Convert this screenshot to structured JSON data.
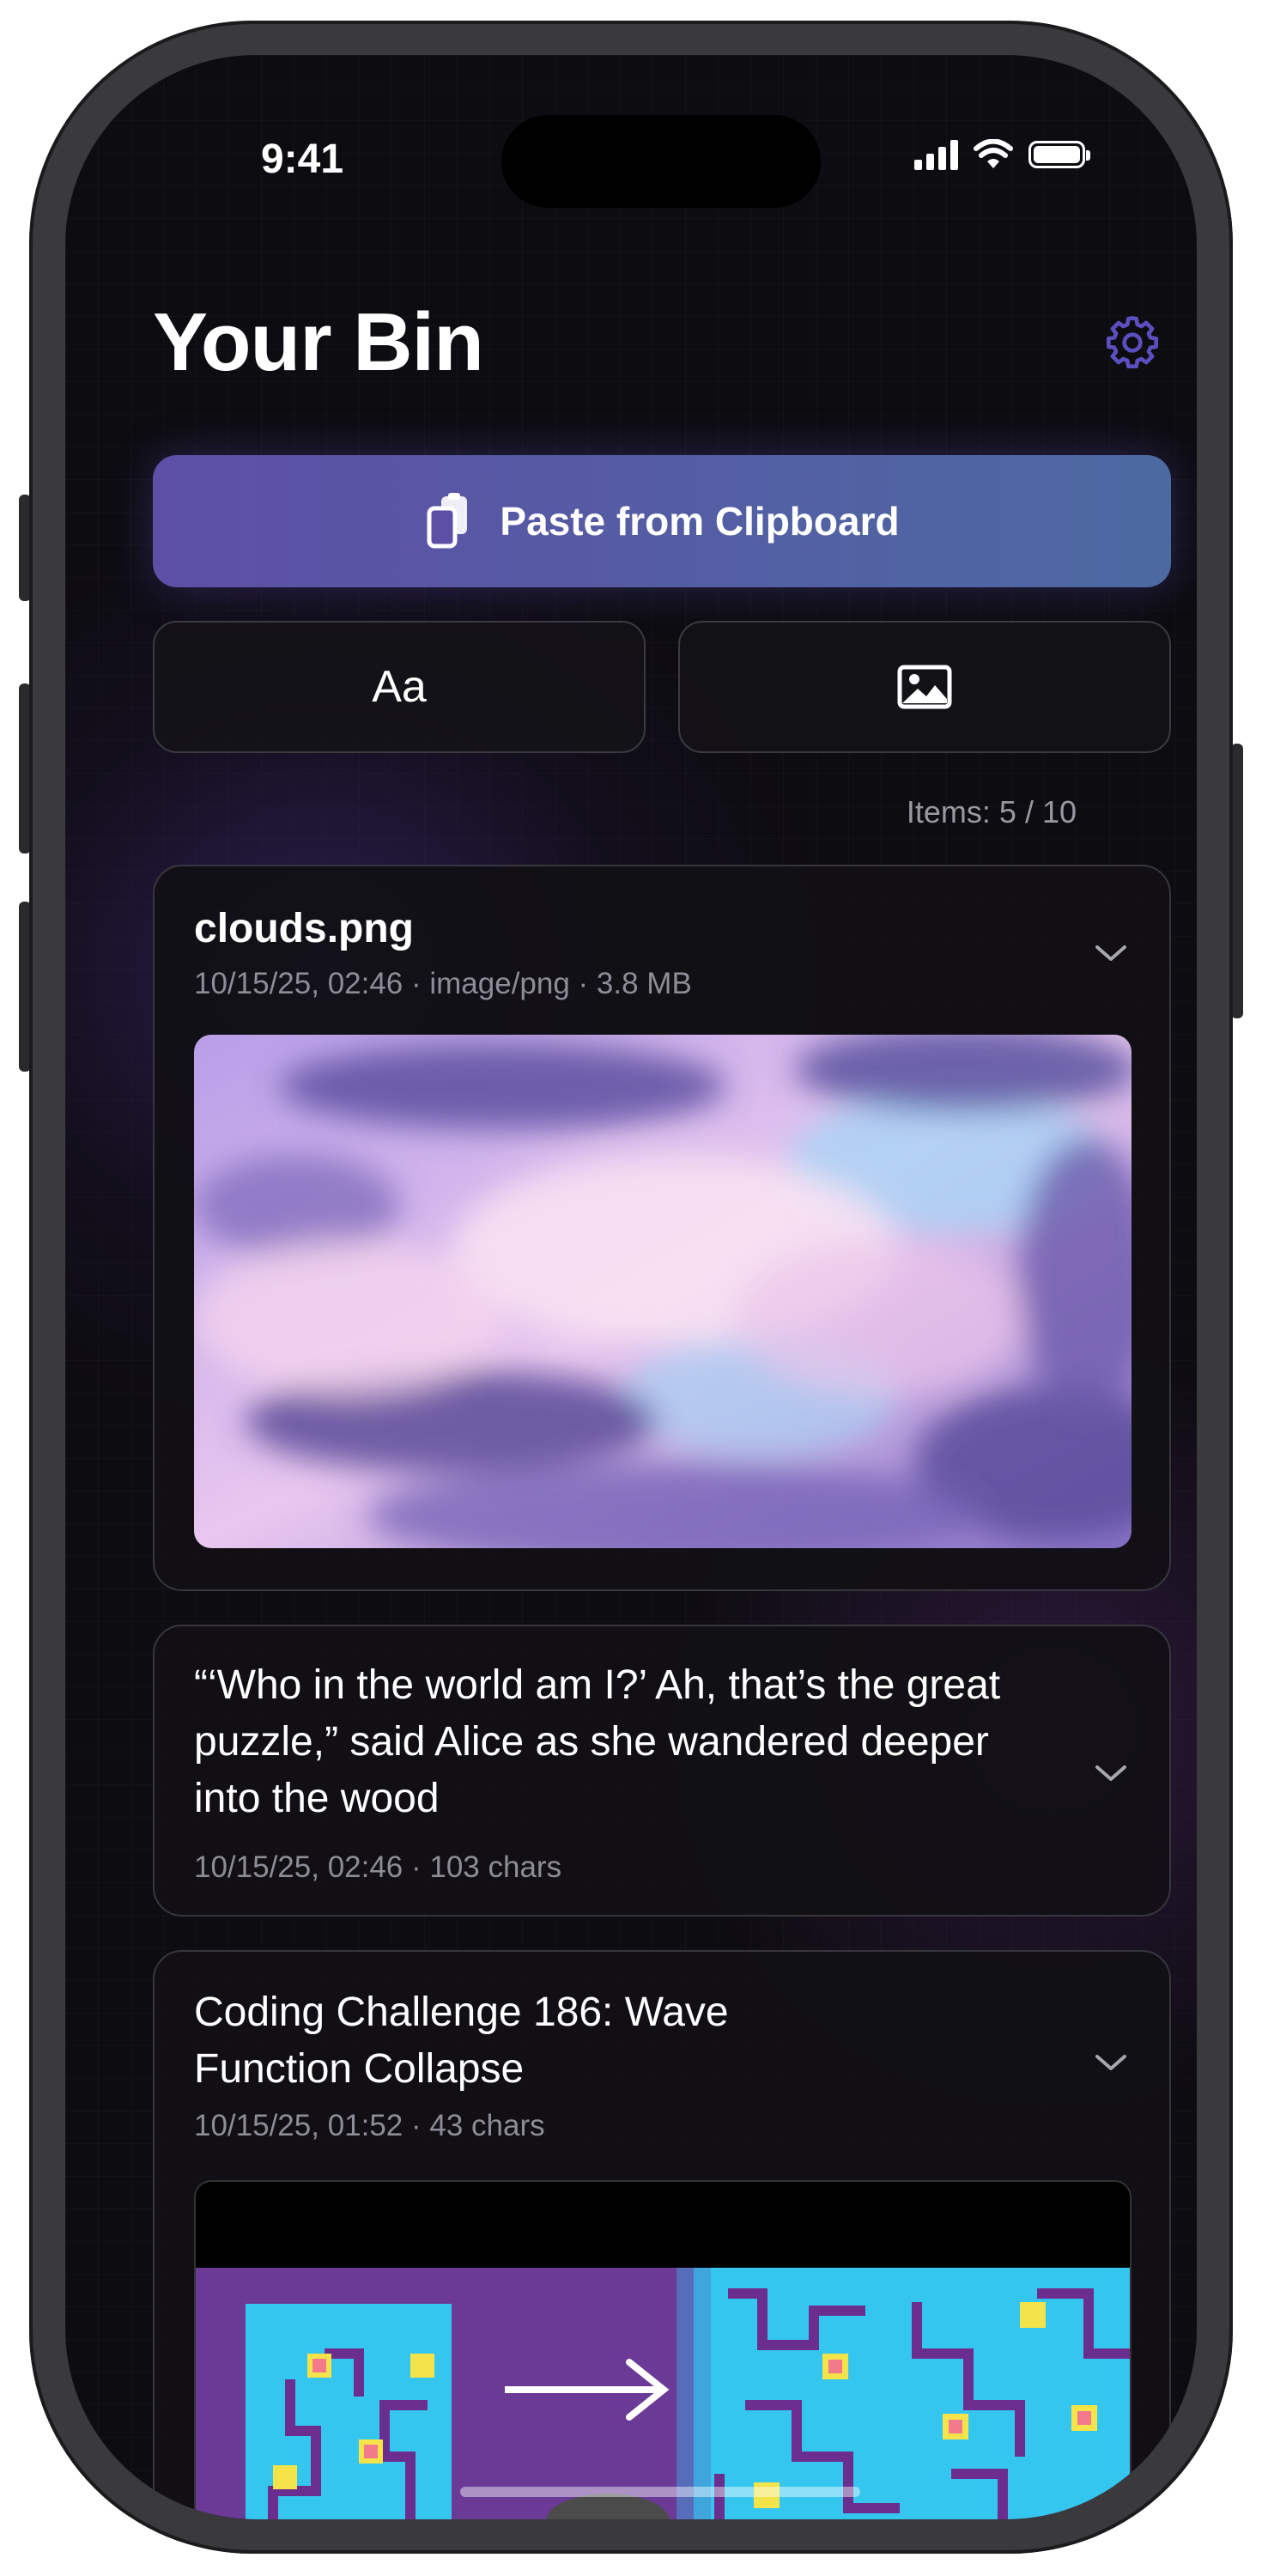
{
  "status_bar": {
    "time": "9:41"
  },
  "header": {
    "title": "Your Bin",
    "settings_icon": "gear-icon"
  },
  "actions": {
    "paste_label": "Paste from Clipboard",
    "text_button_label": "Aa",
    "image_button_icon": "image-icon"
  },
  "items_count": "Items: 5 / 10",
  "items": [
    {
      "title": "clouds.png",
      "meta": "10/15/25, 02:46 · image/png · 3.8 MB",
      "type": "image"
    },
    {
      "title": "“‘Who in the world am I?’ Ah, that’s the great puzzle,” said Alice as she wandered deeper into the wood",
      "meta": "10/15/25, 02:46 · 103 chars",
      "type": "text"
    },
    {
      "title": "Coding Challenge 186: Wave Function Collapse",
      "meta": "10/15/25, 01:52 · 43 chars",
      "type": "link"
    }
  ],
  "colors": {
    "accent_start": "#5d4fa6",
    "accent_end": "#4c6aa2",
    "gear": "#5b4fbf"
  }
}
